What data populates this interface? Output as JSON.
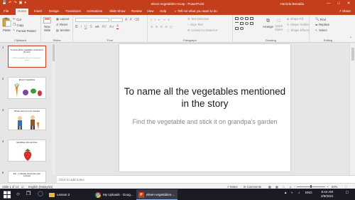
{
  "window": {
    "title": "eliven-vegetables-recap  -  PowerPoint",
    "user": "Harnida Benalda",
    "qat_icons": [
      "save-icon",
      "undo-icon",
      "redo-icon",
      "start-from-beginning-icon",
      "customize-qat-icon"
    ],
    "controls": [
      "—",
      "□",
      "✕"
    ]
  },
  "tabs": [
    {
      "label": "File",
      "active": false
    },
    {
      "label": "Home",
      "active": true
    },
    {
      "label": "Insert",
      "active": false
    },
    {
      "label": "Design",
      "active": false
    },
    {
      "label": "Transitions",
      "active": false
    },
    {
      "label": "Animations",
      "active": false
    },
    {
      "label": "Slide Show",
      "active": false
    },
    {
      "label": "Review",
      "active": false
    },
    {
      "label": "View",
      "active": false
    },
    {
      "label": "Help",
      "active": false
    }
  ],
  "tell_me": "Tell me what you want to do",
  "share": "Share",
  "ribbon": {
    "clipboard": {
      "paste": "Paste",
      "cut": "Cut",
      "copy": "Copy",
      "format_painter": "Format Painter",
      "label": "Clipboard"
    },
    "slides": {
      "new_slide": "New",
      "new_slide2": "Slide",
      "layout": "Layout",
      "reset": "Reset",
      "section": "Section",
      "label": "Slides"
    },
    "font": {
      "label": "Font",
      "font_value": "",
      "size_value": ""
    },
    "paragraph": {
      "text_direction": "Text Direction",
      "align_text": "Align Text",
      "smartart": "Convert to SmartArt",
      "label": "Paragraph"
    },
    "drawing": {
      "arrange": "Arrange",
      "quick_styles": "Quick",
      "quick_styles2": "Styles",
      "shape_fill": "Shape Fill",
      "shape_outline": "Shape Outline",
      "shape_effects": "Shape Effects",
      "label": "Drawing"
    },
    "editing": {
      "find": "Find",
      "replace": "Replace",
      "select": "Select",
      "label": "Editing"
    }
  },
  "slides": [
    {
      "num": "1",
      "title": "To name all the vegetables mentioned in the story",
      "subtitle": "Find the vegetable and stick it on grandpa's garden",
      "active": true
    },
    {
      "num": "2",
      "title": "Eliven's Vegetables",
      "subtitle": "",
      "active": false
    },
    {
      "num": "3",
      "title": "Whose carrot is in the Grandpa",
      "subtitle": "",
      "active": false
    },
    {
      "num": "4",
      "title": "Eat Elliven who are Draw",
      "subtitle": "",
      "active": false
    },
    {
      "num": "5",
      "title": "Elli... or Marclay sliced that mean Lostreed",
      "subtitle": "",
      "active": false
    }
  ],
  "main_slide": {
    "title": "To name all the vegetables mentioned in the story",
    "subtitle": "Find the vegetable and stick it on grandpa's garden"
  },
  "notes_placeholder": "Click to add notes",
  "status": {
    "slide_info": "Slide 1 of 14",
    "language": "English (Malaysia)",
    "notes": "Notes",
    "comments": "Comments",
    "zoom": "60%",
    "zoom_fraction": 0.6
  },
  "taskbar": {
    "apps": [
      {
        "label": "Lesson 2",
        "icon": "file-explorer-icon",
        "active": false
      },
      {
        "label": "My Uploads - Goog...",
        "icon": "chrome-icon",
        "active": false
      },
      {
        "label": "eliven-vegetables-...",
        "icon": "powerpoint-icon",
        "active": true
      }
    ],
    "lang": "ENG",
    "time": "8:44 AM",
    "date": "2/9/2021"
  },
  "colors": {
    "accent": "#c43e1c",
    "taskbar": "#1b1b26",
    "ribbon": "#f3f3f3"
  }
}
